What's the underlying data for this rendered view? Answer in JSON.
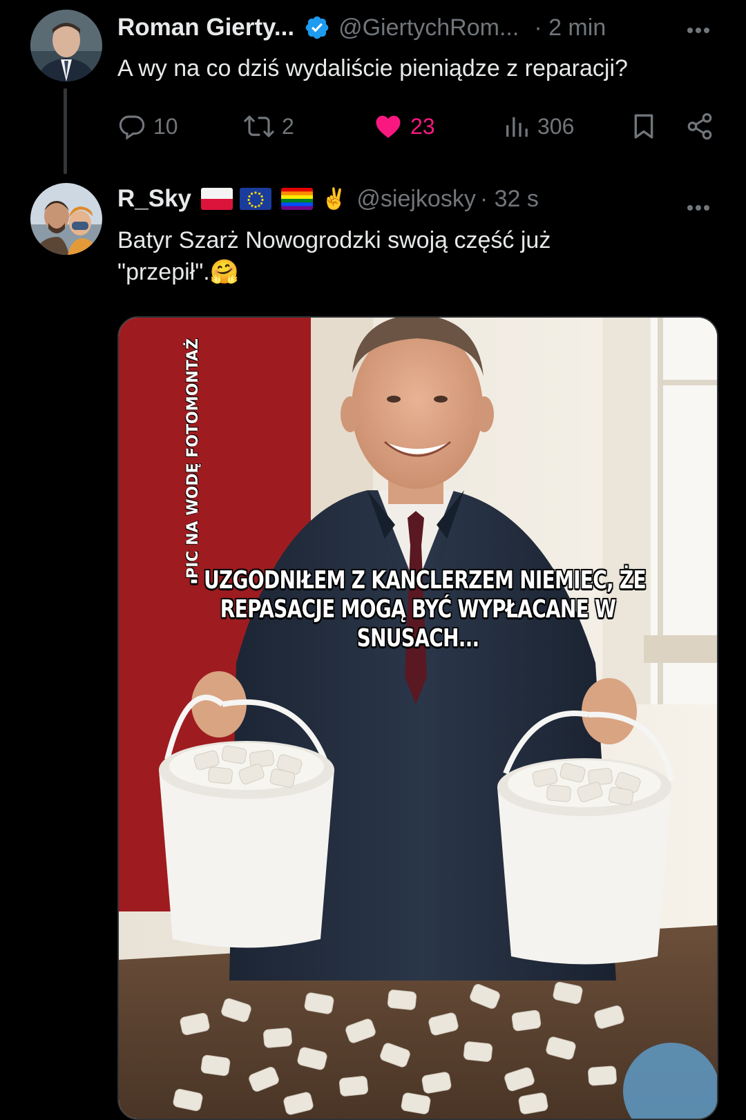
{
  "tweet1": {
    "name": "Roman Gierty...",
    "handle": "@GiertychRom...",
    "time": "· 2 min",
    "text": "A wy na co dziś wydaliście pieniądze z reparacji?",
    "actions": {
      "replies": "10",
      "retweets": "2",
      "likes": "23",
      "views": "306"
    }
  },
  "tweet2": {
    "name": "R_Sky",
    "handle": "@siejkosky",
    "time": "· 32 s",
    "emoji_peace": "✌️",
    "text_line1": "Batyr Szarż Nowogrodzki swoją część już",
    "text_line2": "\"przepił\".",
    "emoji_hug": "🤗"
  },
  "media": {
    "watermark": "PIC NA WODĘ FOTOMONTAŻ",
    "caption_line1": "- UZGODNIŁEM Z KANCLERZEM NIEMIEC, ŻE",
    "caption_line2": "REPASACJE MOGĄ BYĆ WYPŁACANE W SNUSACH..."
  },
  "colors": {
    "background": "#000000",
    "text": "#e7e9ea",
    "muted": "#71767b",
    "like": "#f91880",
    "verified": "#1d9bf0"
  },
  "icons": [
    "reply-icon",
    "retweet-icon",
    "heart-icon",
    "views-icon",
    "bookmark-icon",
    "share-icon",
    "verified-badge-icon",
    "more-icon"
  ]
}
